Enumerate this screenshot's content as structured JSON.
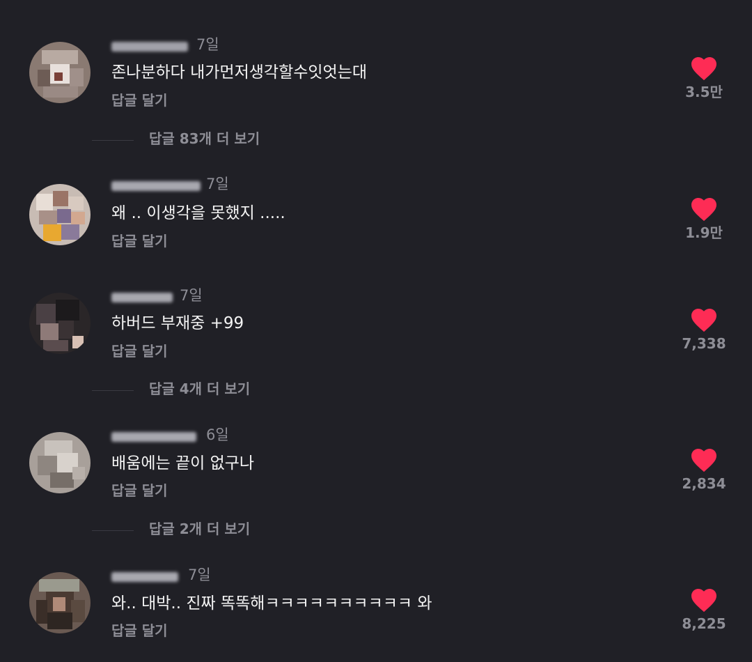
{
  "comments": [
    {
      "time": "7일",
      "text": "존나분하다 내가먼저생각할수잇엇는대",
      "reply_label": "답글 달기",
      "likes": "3.5만"
    },
    {
      "time": "7일",
      "text": "왜 .. 이생각을 못했지 .....",
      "reply_label": "답글 달기",
      "likes": "1.9만"
    },
    {
      "time": "7일",
      "text": "하버드 부재중 +99",
      "reply_label": "답글 달기",
      "likes": "7,338"
    },
    {
      "time": "6일",
      "text": "배움에는 끝이 없구나",
      "reply_label": "답글 달기",
      "likes": "2,834"
    },
    {
      "time": "7일",
      "text": "와.. 대박.. 진짜 똑똑해ㅋㅋㅋㅋㅋㅋㅋㅋㅋㅋ 와",
      "reply_label": "답글 달기",
      "likes": "8,225"
    }
  ],
  "more_replies": [
    {
      "label": "답글 83개 더 보기"
    },
    {
      "label": "답글 4개 더 보기"
    },
    {
      "label": "답글 2개 더 보기"
    }
  ],
  "colors": {
    "background": "#202026",
    "primary_text": "#f4f4f4",
    "secondary_text": "#8e8e96",
    "heart": "#fe2c55"
  },
  "icons": {
    "like": "heart-icon"
  }
}
